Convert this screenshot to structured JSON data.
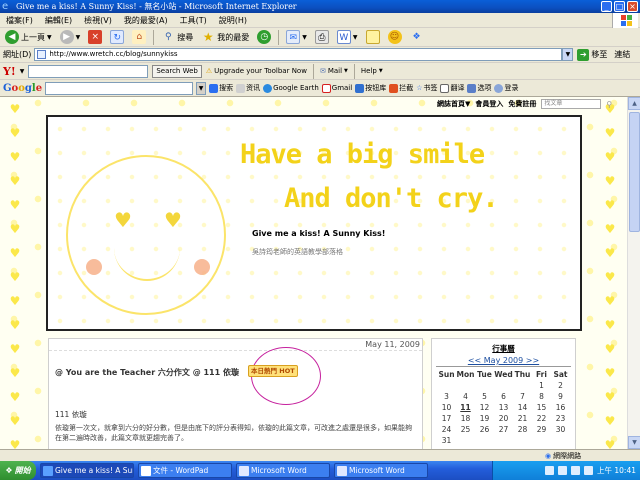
{
  "window": {
    "title": "Give me a kiss! A Sunny Kiss! - 無名小站 - Microsoft Internet Explorer"
  },
  "menu": [
    "檔案(F)",
    "編輯(E)",
    "檢視(V)",
    "我的最愛(A)",
    "工具(T)",
    "說明(H)"
  ],
  "toolbar": {
    "back_label": "上一頁",
    "search_label": "搜尋",
    "favorites_label": "我的最愛"
  },
  "address": {
    "label": "網址(D)",
    "url": "http://www.wretch.cc/blog/sunnykiss",
    "go_label": "移至",
    "links_label": "連結"
  },
  "yahoo": {
    "search_button": "Search Web",
    "upgrade_label": "Upgrade your Toolbar Now",
    "mail_label": "Mail",
    "help_label": "Help"
  },
  "google": {
    "search_label": "搜索",
    "news_label": "资讯",
    "earth_label": "Google Earth",
    "gmail_label": "Gmail",
    "store_label": "按钮库",
    "block_label": "拦截",
    "bookmarks_label": "书签",
    "translate_label": "翻译",
    "options_label": "选项",
    "login_label": "登录"
  },
  "blog_nav": {
    "home": "網誌首頁▼",
    "login": "會員登入",
    "signup": "免費註冊",
    "search_placeholder": "找文章"
  },
  "banner": {
    "slogan_line1": "Have a big smile",
    "slogan_line2": "And don't cry.",
    "blog_title": "Give me a kiss! A Sunny Kiss!",
    "blog_subtitle": "吳詩筠老師的英語教學部落格"
  },
  "post": {
    "date": "May 11, 2009",
    "title": "@ You are the Teacher 六分作文 @ 111 依璇",
    "hot_badge": "本日熱門 HOT",
    "author_line": "111 依璇",
    "body": "依璇第一次文，就拿到六分的好分數，但是由底下的評分表得知，依璇的此篇文章，可改進之處還是很多，如果能夠在第二遍時改善，此篇文章就更趨完善了。"
  },
  "calendar": {
    "heading": "行事曆",
    "month_label": "<< May 2009 >>",
    "dow": [
      "Sun",
      "Mon",
      "Tue",
      "Wed",
      "Thu",
      "Fri",
      "Sat"
    ],
    "rows": [
      [
        "",
        "",
        "",
        "",
        "",
        "1",
        "2"
      ],
      [
        "3",
        "4",
        "5",
        "6",
        "7",
        "8",
        "9"
      ],
      [
        "10",
        "11",
        "12",
        "13",
        "14",
        "15",
        "16"
      ],
      [
        "17",
        "18",
        "19",
        "20",
        "21",
        "22",
        "23"
      ],
      [
        "24",
        "25",
        "26",
        "27",
        "28",
        "29",
        "30"
      ],
      [
        "31",
        "",
        "",
        "",
        "",
        "",
        ""
      ]
    ],
    "today": "11"
  },
  "status": {
    "zone_label": "網際網路"
  },
  "taskbar": {
    "start_label": "開始",
    "tasks": [
      "Give me a kiss! A Sunny ...",
      "文件 - WordPad",
      "Microsoft Word",
      "Microsoft Word"
    ],
    "clock": "上午 10:41"
  }
}
